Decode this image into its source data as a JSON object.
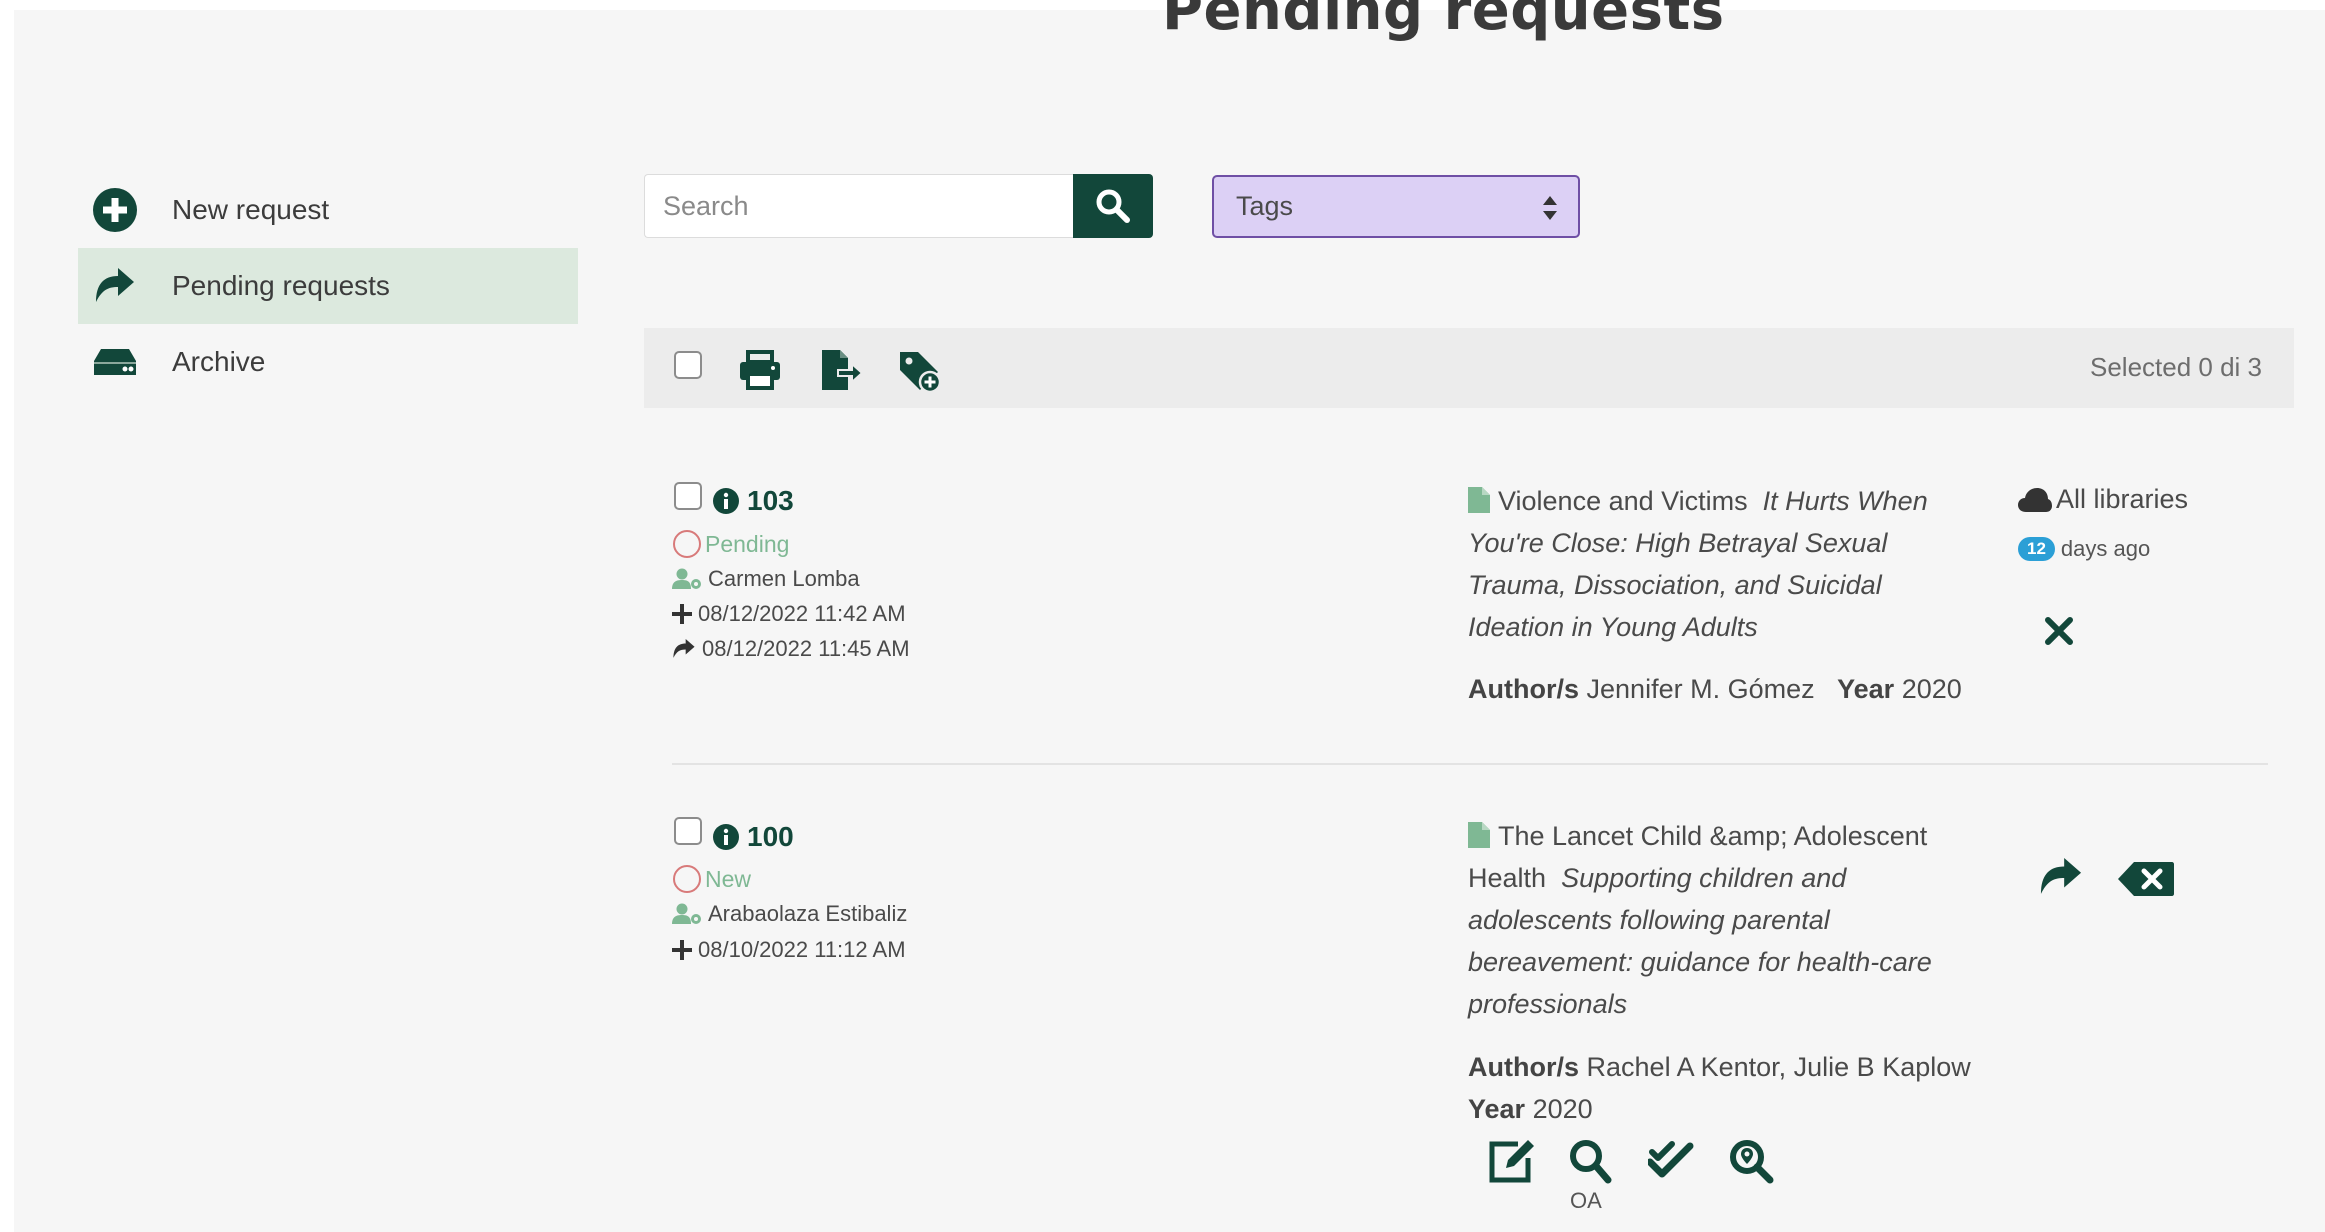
{
  "page": {
    "title": "Pending requests"
  },
  "sidebar": {
    "items": [
      {
        "label": "New request",
        "icon": "plus-circle-icon"
      },
      {
        "label": "Pending requests",
        "icon": "share-arrow-icon",
        "active": true
      },
      {
        "label": "Archive",
        "icon": "hdd-icon"
      }
    ]
  },
  "search": {
    "placeholder": "Search",
    "value": ""
  },
  "tags": {
    "label": "Tags"
  },
  "toolbar": {
    "selected_text": "Selected 0 di 3"
  },
  "requests": [
    {
      "id": "103",
      "status": "Pending",
      "user": "Carmen Lomba",
      "created": "08/12/2022 11:42 AM",
      "forwarded": "08/12/2022 11:45 AM",
      "journal": "Violence and Victims",
      "article_title": "It Hurts When You're Close: High Betrayal Sexual Trauma, Dissociation, and Suicidal Ideation in Young Adults",
      "authors_label": "Author/s",
      "authors": "Jennifer M. Gómez",
      "year_label": "Year",
      "year": "2020",
      "library": "All libraries",
      "days_count": "12",
      "days_label": "days ago"
    },
    {
      "id": "100",
      "status": "New",
      "user": "Arabaolaza Estibaliz",
      "created": "08/10/2022 11:12 AM",
      "journal": "The Lancet Child &amp; Adolescent Health",
      "article_title": "Supporting children and adolescents following parental bereavement: guidance for health-care professionals",
      "authors_label": "Author/s",
      "authors": "Rachel A Kentor, Julie B Kaplow",
      "year_label": "Year",
      "year": "2020",
      "oa_label": "OA"
    }
  ],
  "colors": {
    "accent": "#12473a",
    "active_bg": "#dce9de",
    "tags_bg": "#dcd0f5",
    "badge": "#2b9fd6"
  }
}
